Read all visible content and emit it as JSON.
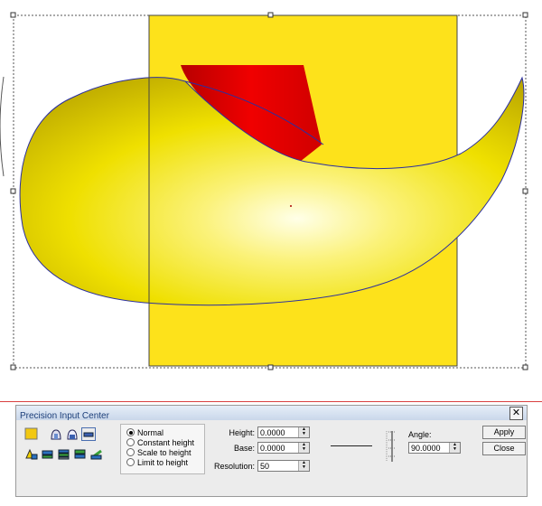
{
  "panel": {
    "title": "Precision Input Center",
    "close_glyph": "✕",
    "tool_icons": [
      "color-swatch-icon",
      "dome-icon",
      "dome-alt-icon",
      "flat-icon",
      "relief-tool-1-icon",
      "relief-tool-2-icon",
      "relief-tool-3-icon",
      "relief-tool-4-icon",
      "relief-tool-5-icon"
    ],
    "swatch_color": "#f2c812",
    "modes": [
      {
        "label": "Normal",
        "selected": true
      },
      {
        "label": "Constant height",
        "selected": false
      },
      {
        "label": "Scale to height",
        "selected": false
      },
      {
        "label": "Limit to height",
        "selected": false
      }
    ],
    "height_label": "Height:",
    "height_value": "0.0000",
    "base_label": "Base:",
    "base_value": "0.0000",
    "resolution_label": "Resolution:",
    "resolution_value": "50",
    "angle_label": "Angle:",
    "angle_value": "90.0000",
    "apply_label": "Apply",
    "close_label": "Close"
  },
  "canvas": {
    "rect_color": "#fde21b",
    "shape_color": "#f3e300",
    "cap_color": "#e60000",
    "outline_color": "#2b2fa0"
  }
}
